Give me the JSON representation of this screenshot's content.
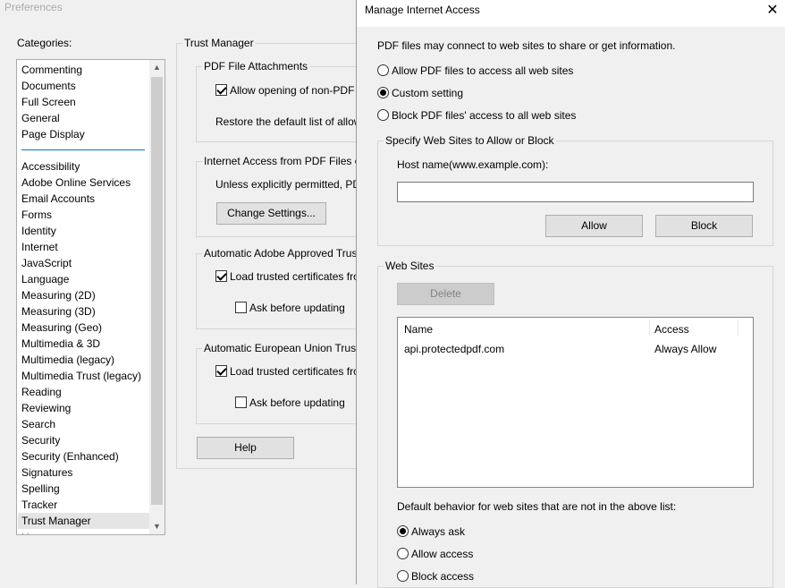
{
  "preferences": {
    "window_title": "Preferences",
    "categories_label": "Categories:",
    "categories_top": [
      "Commenting",
      "Documents",
      "Full Screen",
      "General",
      "Page Display"
    ],
    "categories": [
      "Accessibility",
      "Adobe Online Services",
      "Email Accounts",
      "Forms",
      "Identity",
      "Internet",
      "JavaScript",
      "Language",
      "Measuring (2D)",
      "Measuring (3D)",
      "Measuring (Geo)",
      "Multimedia & 3D",
      "Multimedia (legacy)",
      "Multimedia Trust (legacy)",
      "Reading",
      "Reviewing",
      "Search",
      "Security",
      "Security (Enhanced)",
      "Signatures",
      "Spelling",
      "Tracker",
      "Trust Manager"
    ],
    "selected_category": "Trust Manager",
    "panel_title": "Trust Manager",
    "pdf_attachments": {
      "legend": "PDF File Attachments",
      "allow_label": "Allow opening of non-PDF",
      "allow_checked": true,
      "restore_text": "Restore the default list of allow"
    },
    "internet_access": {
      "legend": "Internet Access from PDF Files o",
      "unless_text": "Unless explicitly permitted, PD",
      "change_settings": "Change Settings..."
    },
    "adobe_approved": {
      "legend": "Automatic Adobe Approved Trus",
      "load_label": "Load trusted certificates fro",
      "load_checked": true,
      "ask_label": "Ask before updating",
      "ask_checked": false
    },
    "eu_trust": {
      "legend": "Automatic European Union Trust",
      "load_label": "Load trusted certificates fro",
      "load_checked": true,
      "ask_label": "Ask before updating",
      "ask_checked": false
    },
    "help_button": "Help"
  },
  "dialog": {
    "title": "Manage Internet Access",
    "close_glyph": "✕",
    "intro": "PDF files may connect to web sites to share or get information.",
    "options": [
      {
        "label": "Allow PDF files to access all web sites",
        "checked": false
      },
      {
        "label": "Custom setting",
        "checked": true
      },
      {
        "label": "Block PDF files' access to all web sites",
        "checked": false
      }
    ],
    "specify_legend": "Specify Web Sites to Allow or Block",
    "host_label": "Host name(www.example.com):",
    "host_value": "",
    "allow_button": "Allow",
    "block_button": "Block",
    "websites_legend": "Web Sites",
    "delete_button": "Delete",
    "table": {
      "columns": [
        "Name",
        "Access"
      ],
      "rows": [
        {
          "name": "api.protectedpdf.com",
          "access": "Always Allow"
        }
      ]
    },
    "default_behavior_label": "Default behavior for web sites that are not in the above list:",
    "default_options": [
      {
        "label": "Always ask",
        "checked": true
      },
      {
        "label": "Allow access",
        "checked": false
      },
      {
        "label": "Block access",
        "checked": false
      }
    ]
  }
}
